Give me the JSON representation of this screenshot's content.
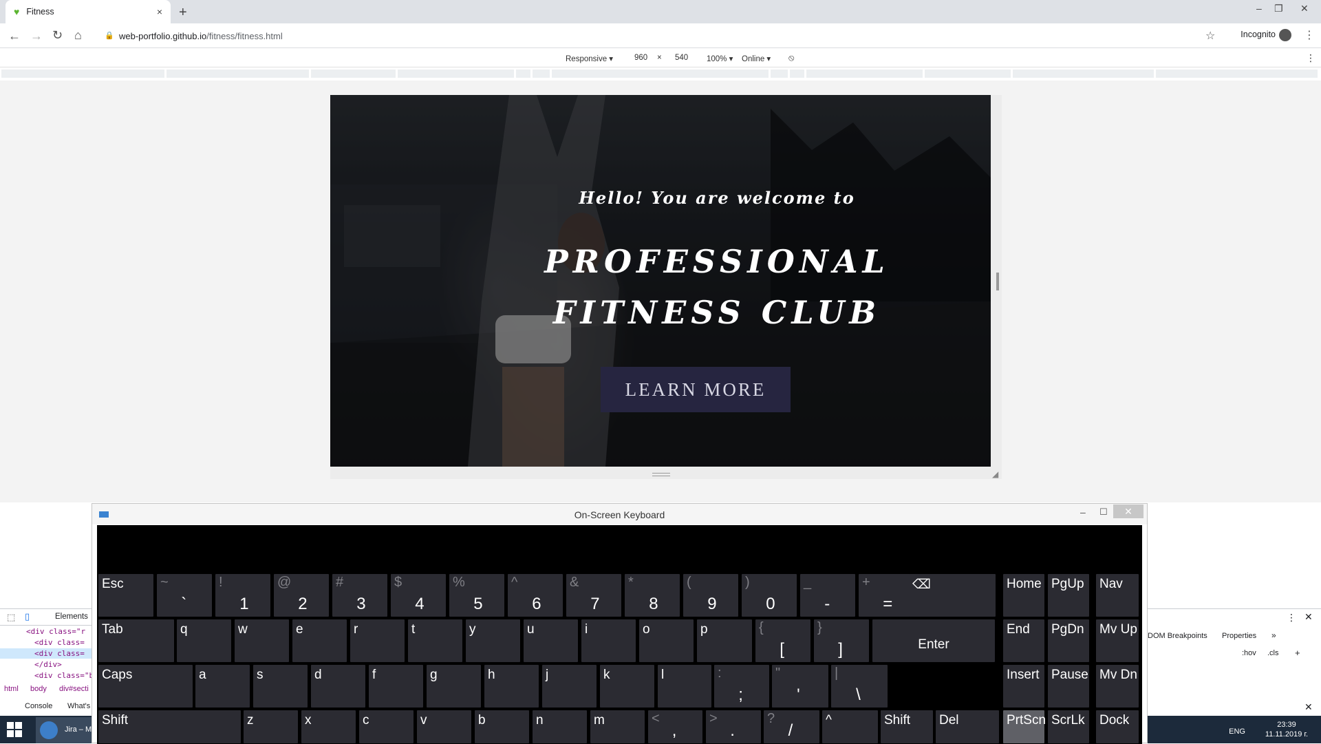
{
  "browser": {
    "tab_title": "Fitness",
    "tab_close": "×",
    "new_tab": "+",
    "url_host": "web-portfolio.github.io",
    "url_path": "/fitness/fitness.html",
    "profile": "Incognito"
  },
  "device_toolbar": {
    "mode": "Responsive ▾",
    "width": "960",
    "times": "×",
    "height": "540",
    "zoom": "100% ▾",
    "network": "Online ▾"
  },
  "hero": {
    "welcome": "Hello! You are welcome to",
    "title_line1": "PROFESSIONAL",
    "title_line2": "FITNESS CLUB",
    "cta": "LEARN MORE"
  },
  "devtools": {
    "tab_elements": "Elements",
    "lines": [
      "<div class=\"r",
      "<div class=",
      "<div class=",
      "</div>",
      "<div class=\"b"
    ],
    "crumbs": [
      "html",
      "body",
      "div#secti"
    ],
    "drawer_tabs": [
      "Console",
      "What's"
    ],
    "right_tabs": [
      "DOM Breakpoints",
      "Properties",
      "»"
    ],
    "filter_hov": ":hov",
    "filter_cls": ".cls",
    "filter_add": "+"
  },
  "taskbar": {
    "app": "Jira – M",
    "lang": "ENG",
    "time": "23:39",
    "date": "11.11.2019 г."
  },
  "keyboard": {
    "title": "On-Screen Keyboard",
    "rows": {
      "r1": [
        {
          "id": "esc",
          "label": "Esc"
        },
        {
          "id": "backtick",
          "top": "~",
          "main": "`"
        },
        {
          "id": "1",
          "top": "!",
          "main": "1"
        },
        {
          "id": "2",
          "top": "@",
          "main": "2"
        },
        {
          "id": "3",
          "top": "#",
          "main": "3"
        },
        {
          "id": "4",
          "top": "$",
          "main": "4"
        },
        {
          "id": "5",
          "top": "%",
          "main": "5"
        },
        {
          "id": "6",
          "top": "^",
          "main": "6"
        },
        {
          "id": "7",
          "top": "&",
          "main": "7"
        },
        {
          "id": "8",
          "top": "*",
          "main": "8"
        },
        {
          "id": "9",
          "top": "(",
          "main": "9"
        },
        {
          "id": "0",
          "top": ")",
          "main": "0"
        },
        {
          "id": "minus",
          "top": "_",
          "main": "-"
        },
        {
          "id": "equals",
          "top": "+",
          "main": "="
        },
        {
          "id": "backspace",
          "label": "⌫"
        },
        {
          "id": "home",
          "label": "Home"
        },
        {
          "id": "pgup",
          "label": "PgUp"
        },
        {
          "id": "nav",
          "label": "Nav"
        }
      ],
      "r2": [
        {
          "id": "tab",
          "label": "Tab"
        },
        {
          "id": "q",
          "label": "q"
        },
        {
          "id": "w",
          "label": "w"
        },
        {
          "id": "e",
          "label": "e"
        },
        {
          "id": "r",
          "label": "r"
        },
        {
          "id": "t",
          "label": "t"
        },
        {
          "id": "y",
          "label": "y"
        },
        {
          "id": "u",
          "label": "u"
        },
        {
          "id": "i",
          "label": "i"
        },
        {
          "id": "o",
          "label": "o"
        },
        {
          "id": "p",
          "label": "p"
        },
        {
          "id": "lbracket",
          "top": "{",
          "main": "["
        },
        {
          "id": "rbracket",
          "top": "}",
          "main": "]"
        },
        {
          "id": "enter",
          "center": "Enter"
        },
        {
          "id": "end",
          "label": "End"
        },
        {
          "id": "pgdn",
          "label": "PgDn"
        },
        {
          "id": "mvup",
          "label": "Mv Up"
        }
      ],
      "r3": [
        {
          "id": "caps",
          "label": "Caps"
        },
        {
          "id": "a",
          "label": "a"
        },
        {
          "id": "s",
          "label": "s"
        },
        {
          "id": "d",
          "label": "d"
        },
        {
          "id": "f",
          "label": "f"
        },
        {
          "id": "g",
          "label": "g"
        },
        {
          "id": "h",
          "label": "h"
        },
        {
          "id": "j",
          "label": "j"
        },
        {
          "id": "k",
          "label": "k"
        },
        {
          "id": "l",
          "label": "l"
        },
        {
          "id": "semicolon",
          "top": ":",
          "main": ";"
        },
        {
          "id": "quote",
          "top": "\"",
          "main": "'"
        },
        {
          "id": "backslash",
          "top": "|",
          "main": "\\"
        },
        {
          "id": "insert",
          "label": "Insert"
        },
        {
          "id": "pause",
          "label": "Pause"
        },
        {
          "id": "mvdn",
          "label": "Mv Dn"
        }
      ],
      "r4": [
        {
          "id": "shift-left",
          "label": "Shift"
        },
        {
          "id": "z",
          "label": "z"
        },
        {
          "id": "x",
          "label": "x"
        },
        {
          "id": "c",
          "label": "c"
        },
        {
          "id": "v",
          "label": "v"
        },
        {
          "id": "b",
          "label": "b"
        },
        {
          "id": "n",
          "label": "n"
        },
        {
          "id": "m",
          "label": "m"
        },
        {
          "id": "comma",
          "top": "<",
          "main": ","
        },
        {
          "id": "period",
          "top": ">",
          "main": "."
        },
        {
          "id": "slash",
          "top": "?",
          "main": "/"
        },
        {
          "id": "up",
          "label": "^"
        },
        {
          "id": "shift-right",
          "label": "Shift"
        },
        {
          "id": "del",
          "label": "Del"
        },
        {
          "id": "prtscn",
          "label": "PrtScn"
        },
        {
          "id": "scrlk",
          "label": "ScrLk"
        },
        {
          "id": "dock",
          "label": "Dock"
        }
      ]
    }
  }
}
